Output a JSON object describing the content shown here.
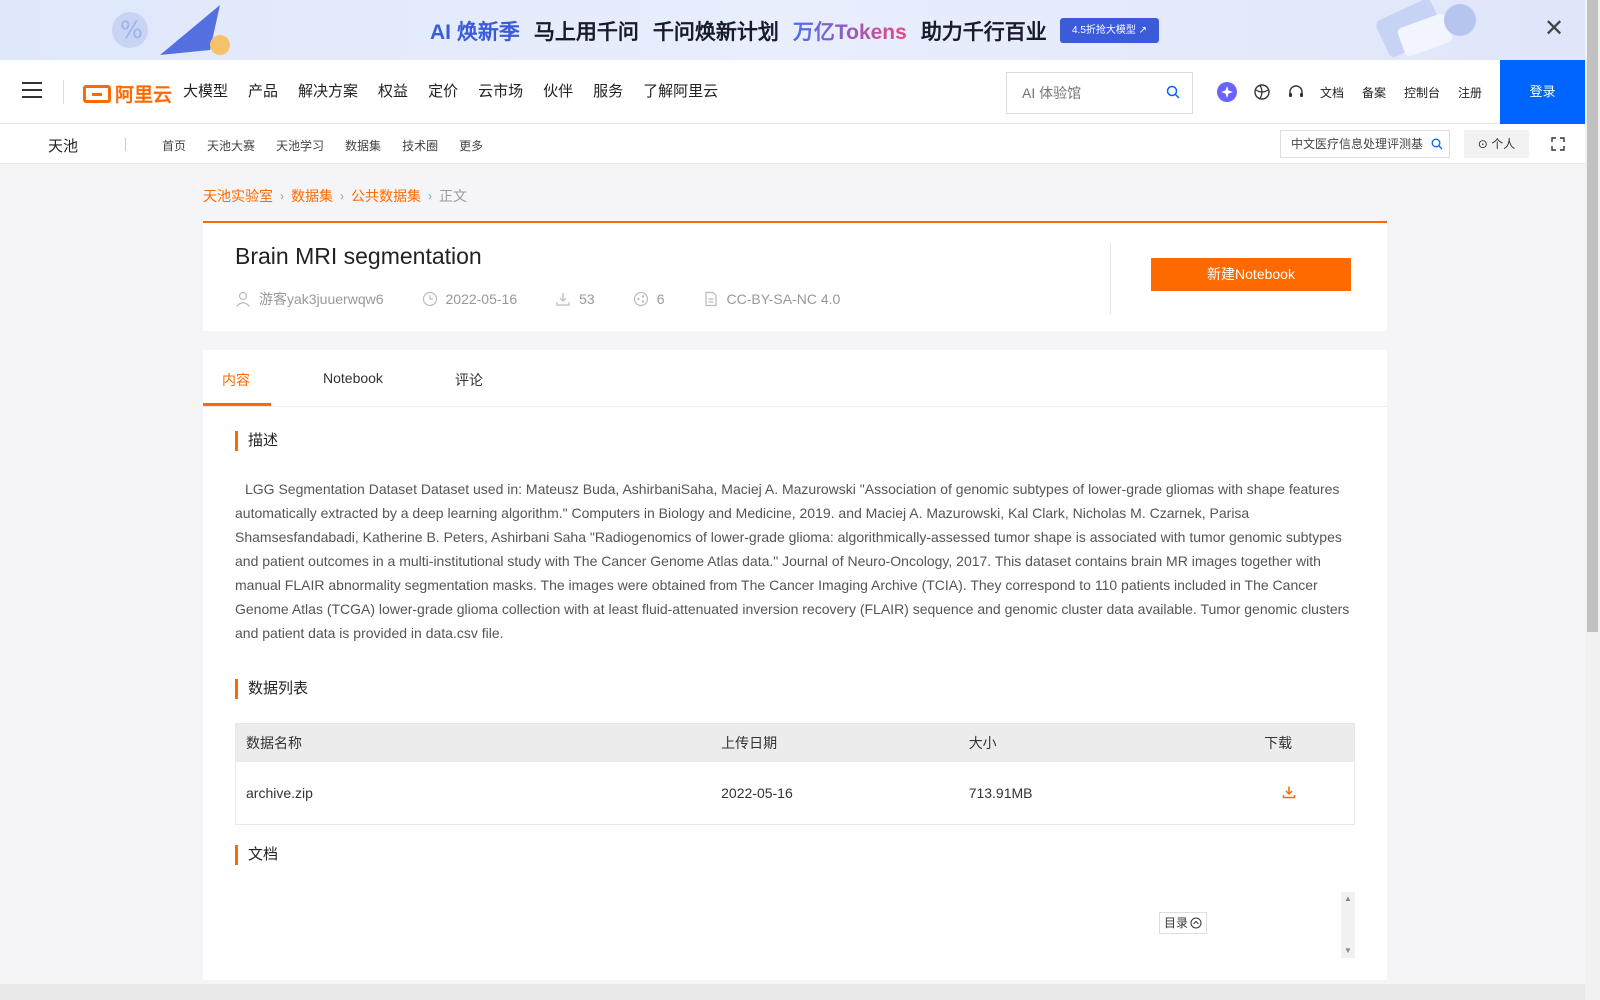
{
  "promo": {
    "ai_label": "AI 焕新季",
    "part1": "马上用千问",
    "part2": "千问焕新计划",
    "part3": "万亿Tokens",
    "part4": "助力千行百业",
    "cta": "4.5折抢大模型 ↗",
    "close": "✕"
  },
  "nav": {
    "logo": "阿里云",
    "items": [
      "大模型",
      "产品",
      "解决方案",
      "权益",
      "定价",
      "云市场",
      "伙伴",
      "服务",
      "了解阿里云"
    ],
    "search_placeholder": "AI 体验馆",
    "links": [
      "文档",
      "备案",
      "控制台",
      "注册"
    ],
    "login": "登录"
  },
  "subnav": {
    "brand": "天池",
    "items": [
      "首页",
      "天池大赛",
      "天池学习",
      "数据集",
      "技术圈",
      "更多"
    ],
    "search_value": "中文医疗信息处理评测基",
    "personal": "个人"
  },
  "breadcrumb": [
    "天池实验室",
    "数据集",
    "公共数据集",
    "正文"
  ],
  "dataset": {
    "title": "Brain MRI segmentation",
    "author": "游客yak3juuerwqw6",
    "date": "2022-05-16",
    "downloads": "53",
    "shares": "6",
    "license": "CC-BY-SA-NC 4.0",
    "new_notebook": "新建Notebook"
  },
  "tabs": [
    "内容",
    "Notebook",
    "评论"
  ],
  "sections": {
    "description_title": "描述",
    "description": "LGG Segmentation Dataset Dataset used in: Mateusz Buda, AshirbaniSaha, Maciej A. Mazurowski \"Association of genomic subtypes of lower-grade gliomas with shape features automatically extracted by a deep learning algorithm.\" Computers in Biology and Medicine, 2019. and Maciej A. Mazurowski, Kal Clark, Nicholas M. Czarnek, Parisa Shamsesfandabadi, Katherine B. Peters, Ashirbani Saha \"Radiogenomics of lower-grade glioma: algorithmically-assessed tumor shape is associated with tumor genomic subtypes and patient outcomes in a multi-institutional study with The Cancer Genome Atlas data.\" Journal of Neuro-Oncology, 2017. This dataset contains brain MR images together with manual FLAIR abnormality segmentation masks. The images were obtained from The Cancer Imaging Archive (TCIA). They correspond to 110 patients included in The Cancer Genome Atlas (TCGA) lower-grade glioma collection with at least fluid-attenuated inversion recovery (FLAIR) sequence and genomic cluster data available. Tumor genomic clusters and patient data is provided in data.csv file.",
    "datalist_title": "数据列表",
    "docs_title": "文档",
    "toc": "目录"
  },
  "table": {
    "headers": [
      "数据名称",
      "上传日期",
      "大小",
      "下载"
    ],
    "rows": [
      {
        "name": "archive.zip",
        "date": "2022-05-16",
        "size": "713.91MB"
      }
    ]
  }
}
